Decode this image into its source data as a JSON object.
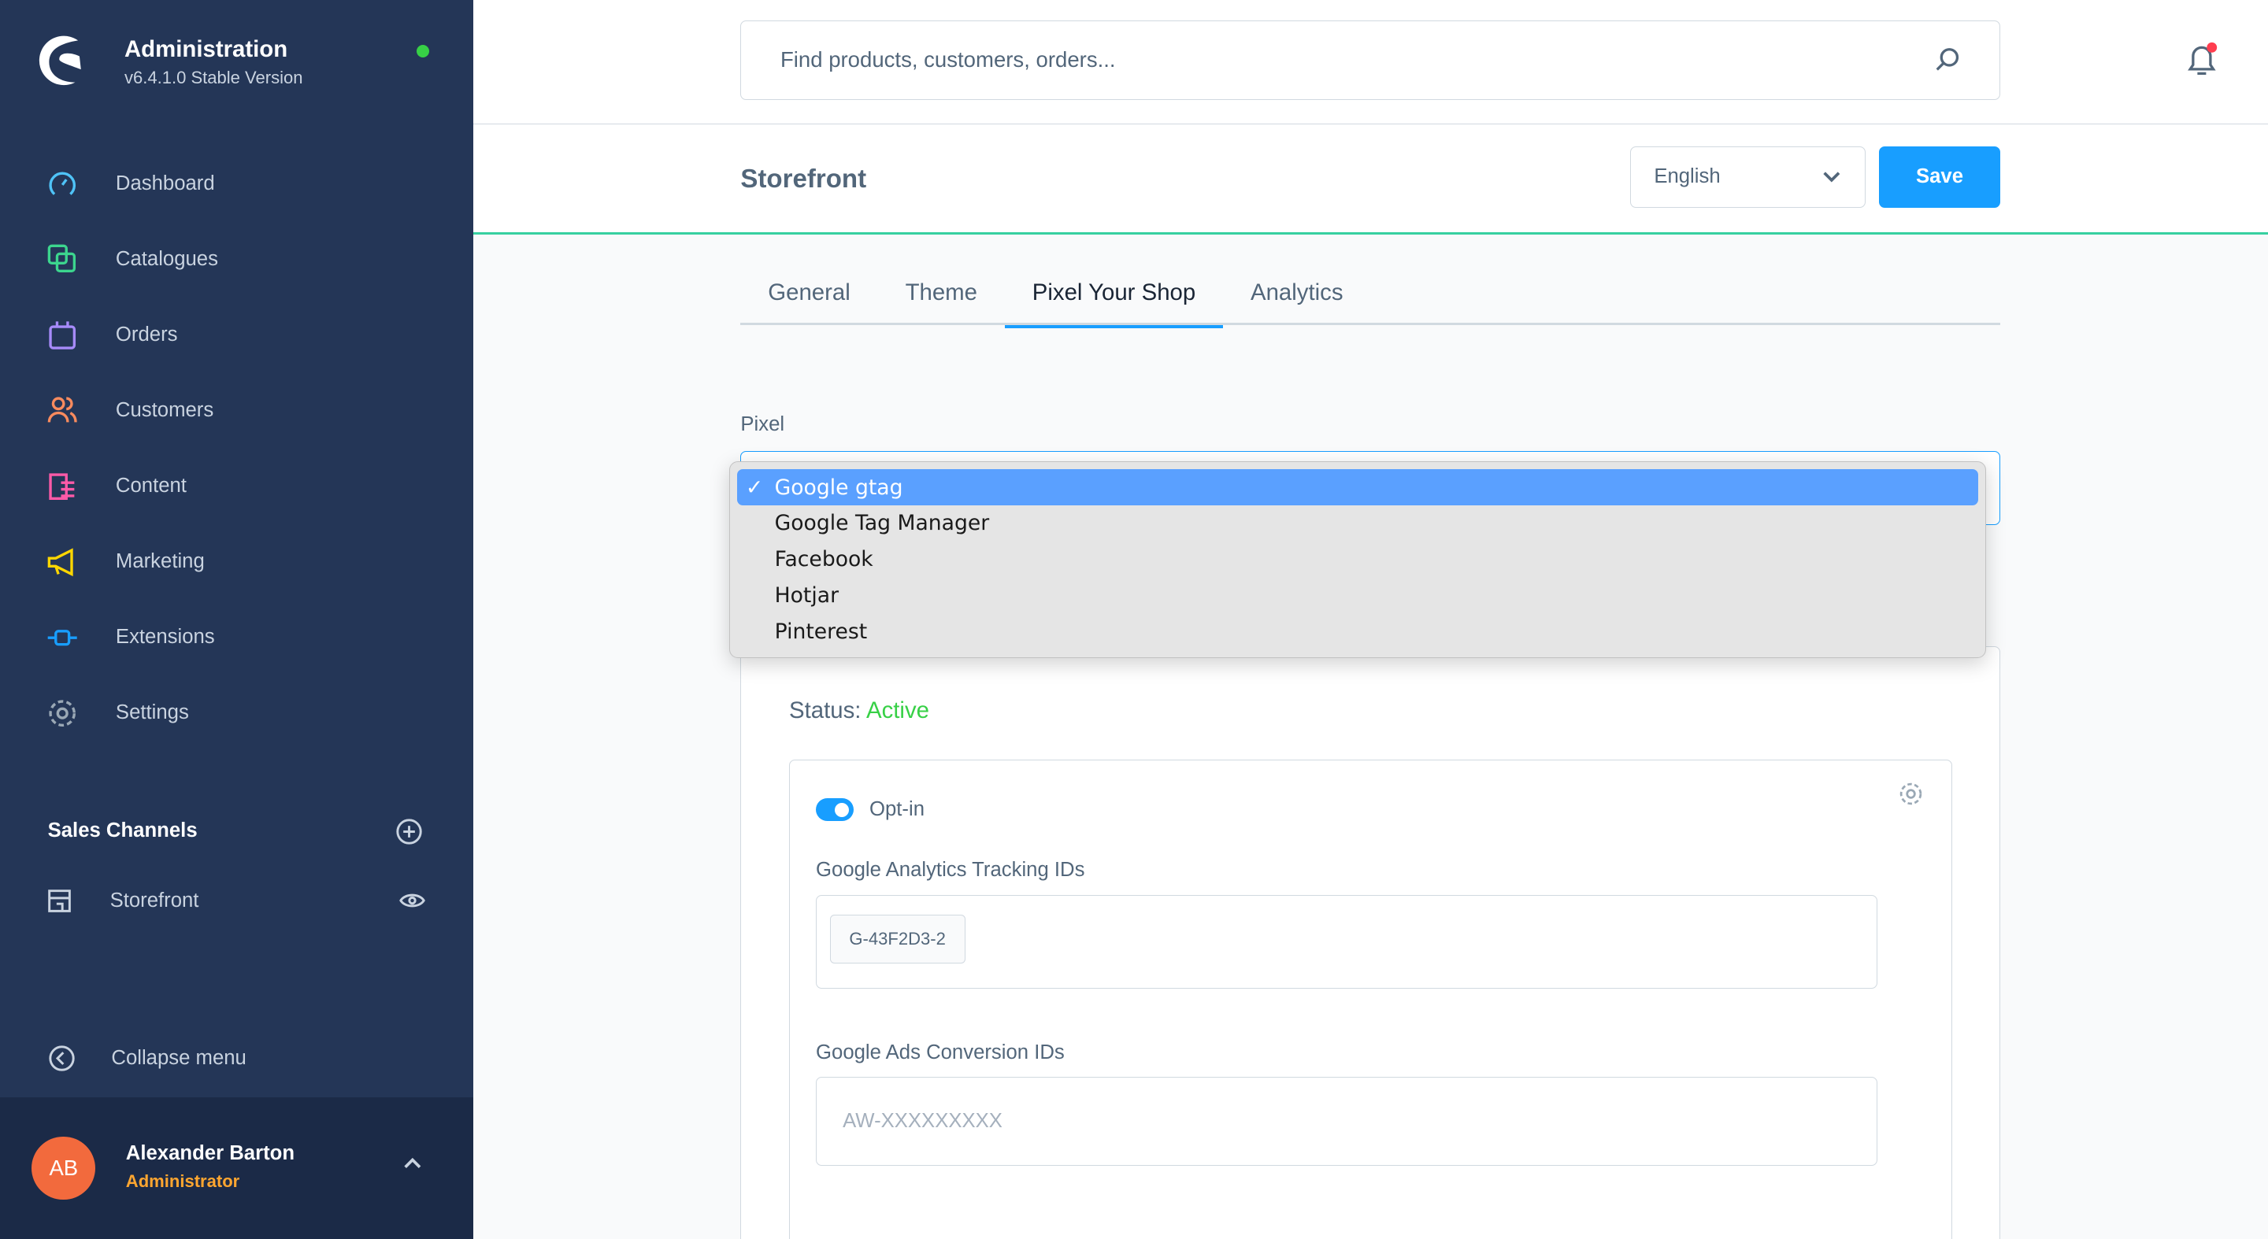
{
  "app": {
    "title": "Administration",
    "version": "v6.4.1.0 Stable Version",
    "status_color": "#37d046"
  },
  "sidebar": {
    "items": [
      {
        "label": "Dashboard",
        "icon": "dashboard-icon",
        "color": "#4fc3f7"
      },
      {
        "label": "Catalogues",
        "icon": "catalogues-icon",
        "color": "#3cd58e"
      },
      {
        "label": "Orders",
        "icon": "orders-icon",
        "color": "#a78bfa"
      },
      {
        "label": "Customers",
        "icon": "customers-icon",
        "color": "#f98b5e"
      },
      {
        "label": "Content",
        "icon": "content-icon",
        "color": "#ff5aa8"
      },
      {
        "label": "Marketing",
        "icon": "marketing-icon",
        "color": "#ffd700"
      },
      {
        "label": "Extensions",
        "icon": "extensions-icon",
        "color": "#189eff"
      },
      {
        "label": "Settings",
        "icon": "settings-icon",
        "color": "#9aa8b5"
      }
    ],
    "sales_channels_title": "Sales Channels",
    "sales_channels": [
      {
        "label": "Storefront"
      }
    ],
    "collapse_label": "Collapse menu"
  },
  "user": {
    "initials": "AB",
    "name": "Alexander Barton",
    "role": "Administrator"
  },
  "search": {
    "placeholder": "Find products, customers, orders..."
  },
  "header": {
    "title": "Storefront",
    "language": "English",
    "save_label": "Save"
  },
  "tabs": [
    {
      "label": "General"
    },
    {
      "label": "Theme"
    },
    {
      "label": "Pixel Your Shop",
      "active": true
    },
    {
      "label": "Analytics"
    }
  ],
  "pixel": {
    "label": "Pixel",
    "options": [
      "Google gtag",
      "Google Tag Manager",
      "Facebook",
      "Hotjar",
      "Pinterest"
    ],
    "selected": "Google gtag",
    "check": "✓"
  },
  "card": {
    "status_label": "Status:",
    "status_value": "Active",
    "optin_label": "Opt-in",
    "optin_on": true,
    "tracking_label": "Google Analytics Tracking IDs",
    "tracking_ids": [
      "G-43F2D3-2"
    ],
    "ads_label": "Google Ads Conversion IDs",
    "ads_placeholder": "AW-XXXXXXXXX"
  }
}
